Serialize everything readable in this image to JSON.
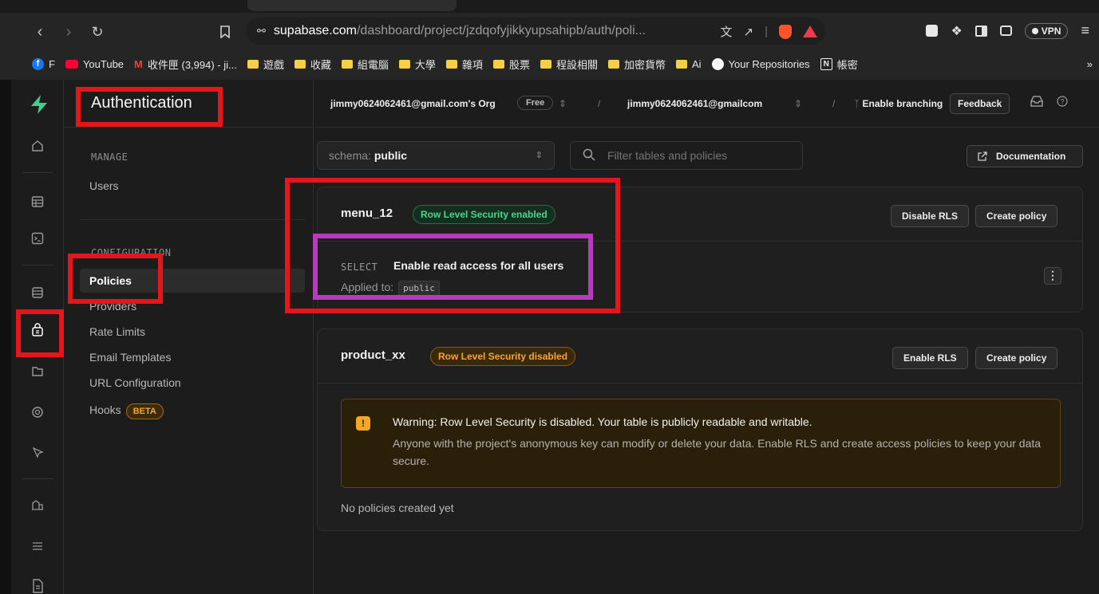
{
  "browser": {
    "url_host": "supabase.com",
    "url_path": "/dashboard/project/jzdqofyjikkyupsahipb/auth/poli...",
    "vpn_label": "VPN",
    "bookmarks": [
      {
        "label": "F",
        "kind": "facebook"
      },
      {
        "label": "YouTube",
        "kind": "youtube"
      },
      {
        "label": "收件匣 (3,994) - ji...",
        "kind": "gmail"
      },
      {
        "label": "遊戲",
        "kind": "folder"
      },
      {
        "label": "收藏",
        "kind": "folder"
      },
      {
        "label": "組電腦",
        "kind": "folder"
      },
      {
        "label": "大學",
        "kind": "folder"
      },
      {
        "label": "雜項",
        "kind": "folder"
      },
      {
        "label": "股票",
        "kind": "folder"
      },
      {
        "label": "程設相關",
        "kind": "folder"
      },
      {
        "label": "加密貨幣",
        "kind": "folder"
      },
      {
        "label": "Ai",
        "kind": "folder"
      },
      {
        "label": "Your Repositories",
        "kind": "github"
      },
      {
        "label": "帳密",
        "kind": "notion"
      }
    ],
    "more_label": "»"
  },
  "sidebar": {
    "title": "Authentication",
    "manage_label": "MANAGE",
    "manage_items": [
      {
        "label": "Users"
      }
    ],
    "config_label": "CONFIGURATION",
    "config_items": [
      {
        "label": "Policies",
        "active": true
      },
      {
        "label": "Providers"
      },
      {
        "label": "Rate Limits"
      },
      {
        "label": "Email Templates"
      },
      {
        "label": "URL Configuration"
      },
      {
        "label": "Hooks",
        "badge": "BETA"
      }
    ]
  },
  "topbar": {
    "org": "jimmy0624062461@gmail.com's Org",
    "plan": "Free",
    "project": "jimmy0624062461@gmailcom",
    "branching": "Enable branching",
    "feedback": "Feedback",
    "separator": "/"
  },
  "filters": {
    "schema_prefix": "schema:",
    "schema_value": "public",
    "search_placeholder": "Filter tables and policies",
    "docs_label": "Documentation"
  },
  "tables": [
    {
      "name": "menu_12",
      "rls_status": "Row Level Security enabled",
      "rls_enabled": true,
      "toggle_label": "Disable RLS",
      "create_label": "Create policy",
      "policies": [
        {
          "command": "SELECT",
          "name": "Enable read access for all users",
          "applied_label": "Applied to:",
          "role": "public"
        }
      ]
    },
    {
      "name": "product_xx",
      "rls_status": "Row Level Security disabled",
      "rls_enabled": false,
      "toggle_label": "Enable RLS",
      "create_label": "Create policy",
      "warning_title": "Warning: Row Level Security is disabled. Your table is publicly readable and writable.",
      "warning_body": "Anyone with the project's anonymous key can modify or delete your data. Enable RLS and create access policies to keep your data secure.",
      "empty_label": "No policies created yet"
    }
  ],
  "colors": {
    "brand_green": "#3ecf8e",
    "annotation_red": "#e4161b",
    "annotation_purple": "#b73bbf"
  }
}
